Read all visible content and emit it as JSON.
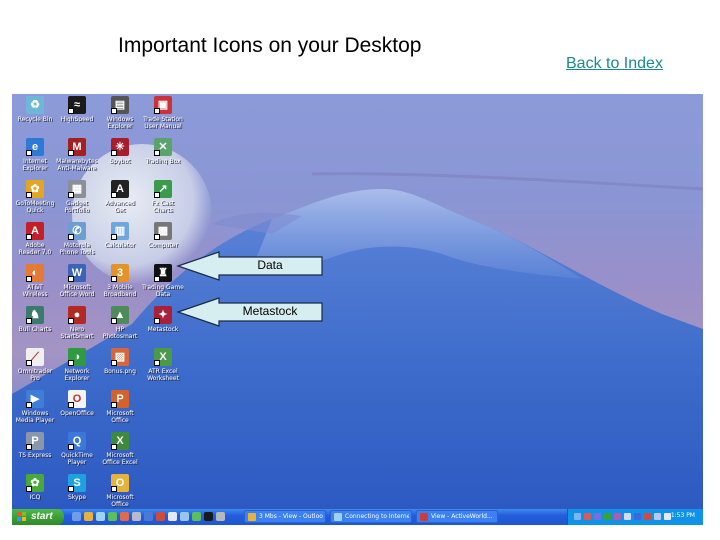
{
  "page": {
    "title": "Important Icons on your Desktop",
    "back_link": "Back to Index"
  },
  "desktop": {
    "icons": [
      {
        "label": "Recycle Bin",
        "icon": "recycle-bin-icon",
        "color": "#6fb7d8",
        "glyph": "♻"
      },
      {
        "label": "HighSpeed",
        "icon": "highspeed-icon",
        "color": "#1a1a1a",
        "glyph": "≈"
      },
      {
        "label": "Windows Explorer",
        "icon": "windows-explorer-icon",
        "color": "#555555",
        "glyph": "▤"
      },
      {
        "label": "Trade Station User Manual",
        "icon": "pdf-manual-icon",
        "color": "#c8323a",
        "glyph": "▣"
      },
      {
        "label": "Internet Explorer",
        "icon": "internet-explorer-icon",
        "color": "#2f79d6",
        "glyph": "e"
      },
      {
        "label": "Malwarebytes Anti-Malware",
        "icon": "malwarebytes-icon",
        "color": "#a32020",
        "glyph": "M"
      },
      {
        "label": "Spybot",
        "icon": "spybot-icon",
        "color": "#a81d2a",
        "glyph": "✳"
      },
      {
        "label": "Trading Box",
        "icon": "trading-box-icon",
        "color": "#5aa36a",
        "glyph": "✕"
      },
      {
        "label": "GoToMeeting Quick Connect",
        "icon": "gotomeeting-icon",
        "color": "#e3a524",
        "glyph": "✿"
      },
      {
        "label": "Gadget Portfolio",
        "icon": "gadget-icon",
        "color": "#8a8f98",
        "glyph": "▦"
      },
      {
        "label": "Advanced Get",
        "icon": "advanced-get-icon",
        "color": "#222222",
        "glyph": "A"
      },
      {
        "label": "Fx Cast Charts",
        "icon": "fx-charts-icon",
        "color": "#3a9b4a",
        "glyph": "↗"
      },
      {
        "label": "Adobe Reader 7.0",
        "icon": "adobe-reader-icon",
        "color": "#c21f27",
        "glyph": "A"
      },
      {
        "label": "Motorola Phone Tools",
        "icon": "phone-tools-icon",
        "color": "#6a9fd0",
        "glyph": "✆"
      },
      {
        "label": "Calculator",
        "icon": "calculator-icon",
        "color": "#6fa6dc",
        "glyph": "▥"
      },
      {
        "label": "Computer",
        "icon": "computer-icon",
        "color": "#777777",
        "glyph": "▩"
      },
      {
        "label": "AT&T Wireless",
        "icon": "att-icon",
        "color": "#e57a35",
        "glyph": "◐"
      },
      {
        "label": "Microsoft Office Word",
        "icon": "word-icon",
        "color": "#3b63b8",
        "glyph": "W"
      },
      {
        "label": "3 Mobile Broadband",
        "icon": "mobile-broadband-icon",
        "color": "#e5922a",
        "glyph": "3"
      },
      {
        "label": "Trading Game Data",
        "icon": "trading-data-icon",
        "color": "#111111",
        "glyph": "♜"
      },
      {
        "label": "Bull Charts",
        "icon": "bull-charts-icon",
        "color": "#3b7a6c",
        "glyph": "♞"
      },
      {
        "label": "Nero StartSmart",
        "icon": "nero-icon",
        "color": "#b32a22",
        "glyph": "●"
      },
      {
        "label": "HP Photosmart Essential",
        "icon": "photosmart-icon",
        "color": "#4f8a5a",
        "glyph": "▲"
      },
      {
        "label": "Metastock",
        "icon": "metastock-icon",
        "color": "#a8203a",
        "glyph": "✦"
      },
      {
        "label": "Omnitrader Pro",
        "icon": "omnitrader-icon",
        "color": "#f0f0f0",
        "glyph": "⟋"
      },
      {
        "label": "Network Explorer",
        "icon": "network-icon",
        "color": "#2f9a3f",
        "glyph": "◑"
      },
      {
        "label": "Bonus.png",
        "icon": "image-file-icon",
        "color": "#d9663a",
        "glyph": "▨"
      },
      {
        "label": "ATR Excel Worksheet",
        "icon": "excel-file-icon",
        "color": "#4a9a4a",
        "glyph": "X"
      },
      {
        "label": "Windows Media Player",
        "icon": "media-player-icon",
        "color": "#3f7ed8",
        "glyph": "▶"
      },
      {
        "label": "OpenOffice",
        "icon": "openoffice-icon",
        "color": "#f4f4f4",
        "glyph": "O"
      },
      {
        "label": "Microsoft Office PowerPoint",
        "icon": "powerpoint-icon",
        "color": "#d4622a",
        "glyph": "P"
      },
      {
        "label": "TS Express",
        "icon": "ts-express-icon",
        "color": "#8a97a8",
        "glyph": "P"
      },
      {
        "label": "QuickTime Player",
        "icon": "quicktime-icon",
        "color": "#3c78d8",
        "glyph": "Q"
      },
      {
        "label": "Microsoft Office Excel",
        "icon": "excel-icon",
        "color": "#3d8a3d",
        "glyph": "X"
      },
      {
        "label": "ICQ",
        "icon": "icq-icon",
        "color": "#48a83a",
        "glyph": "✿"
      },
      {
        "label": "Skype",
        "icon": "skype-icon",
        "color": "#1da1e0",
        "glyph": "S"
      },
      {
        "label": "Microsoft Office Outlook",
        "icon": "outlook-icon",
        "color": "#e8b23a",
        "glyph": "O"
      }
    ],
    "callouts": [
      {
        "label": "Data"
      },
      {
        "label": "Metastock"
      }
    ]
  },
  "taskbar": {
    "start_label": "start",
    "quick_launch": [
      "#6f9ee6",
      "#e8b13a",
      "#9fd2f5",
      "#5bbf5b",
      "#e06b4a",
      "#b9b9c8",
      "#4a7ad8",
      "#d24a3a",
      "#e8e8f4",
      "#9cc3ea",
      "#5bbf5b",
      "#1a1a1a",
      "#b8b8b8"
    ],
    "tasks": [
      {
        "label": "3 Mbs - View - Outlook",
        "color": "#e8b23a"
      },
      {
        "label": "Connecting to Internet...",
        "color": "#9fd2f5"
      },
      {
        "label": "View - ActiveWorld...",
        "color": "#d23a3a"
      }
    ],
    "tray_icons": [
      "#7fb4f0",
      "#d85a5a",
      "#7070e0",
      "#3aa03a",
      "#b05ab0",
      "#d8d8f0",
      "#3a6ad8",
      "#d04a4a",
      "#b8c8f0",
      "#e8e8f8"
    ],
    "clock": "1:53 PM"
  }
}
